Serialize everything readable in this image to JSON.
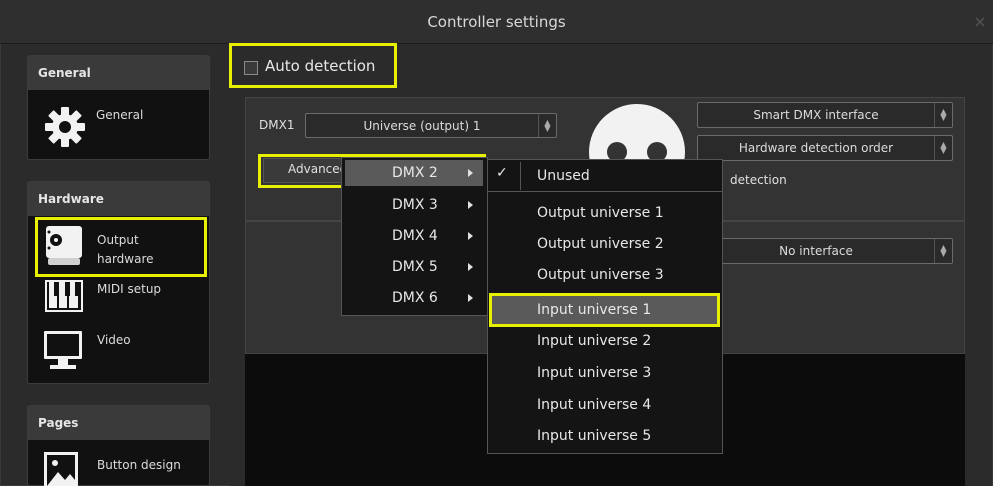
{
  "window": {
    "title": "Controller settings",
    "close_glyph": "×"
  },
  "sidebar": {
    "groups": [
      {
        "header": "General",
        "items": [
          {
            "label": "General",
            "icon": "gear-icon"
          }
        ]
      },
      {
        "header": "Hardware",
        "items": [
          {
            "label": "Output hardware",
            "label_line1": "Output",
            "label_line2": "hardware",
            "icon": "interface-box-icon"
          },
          {
            "label": "MIDI setup",
            "icon": "piano-keys-icon"
          },
          {
            "label": "Video",
            "icon": "monitor-icon"
          }
        ]
      },
      {
        "header": "Pages",
        "items": [
          {
            "label": "Button design",
            "icon": "picture-icon"
          }
        ]
      }
    ]
  },
  "auto_detection": {
    "label": "Auto detection",
    "checked": false
  },
  "dmx_row": {
    "label": "DMX1",
    "universe_select": "Universe (output) 1",
    "advanced_button": "Advanced"
  },
  "right_selects": {
    "interface": "Smart DMX interface",
    "detection_order": "Hardware detection order",
    "detection_label": "detection",
    "second_interface": "No interface"
  },
  "submenu": {
    "items": [
      "DMX 2",
      "DMX 3",
      "DMX 4",
      "DMX 5",
      "DMX 6"
    ],
    "highlighted": "DMX 2"
  },
  "universe_menu": {
    "items": [
      "Unused",
      "Output universe 1",
      "Output universe 2",
      "Output universe 3",
      "Input universe 1",
      "Input universe 2",
      "Input universe 3",
      "Input universe 4",
      "Input universe 5"
    ],
    "checked": "Unused",
    "highlighted": "Input universe 1",
    "check_glyph": "✓"
  },
  "colors": {
    "highlight": "#e6f000",
    "menu_hover": "#5a5a5a",
    "panel": "#333333"
  }
}
